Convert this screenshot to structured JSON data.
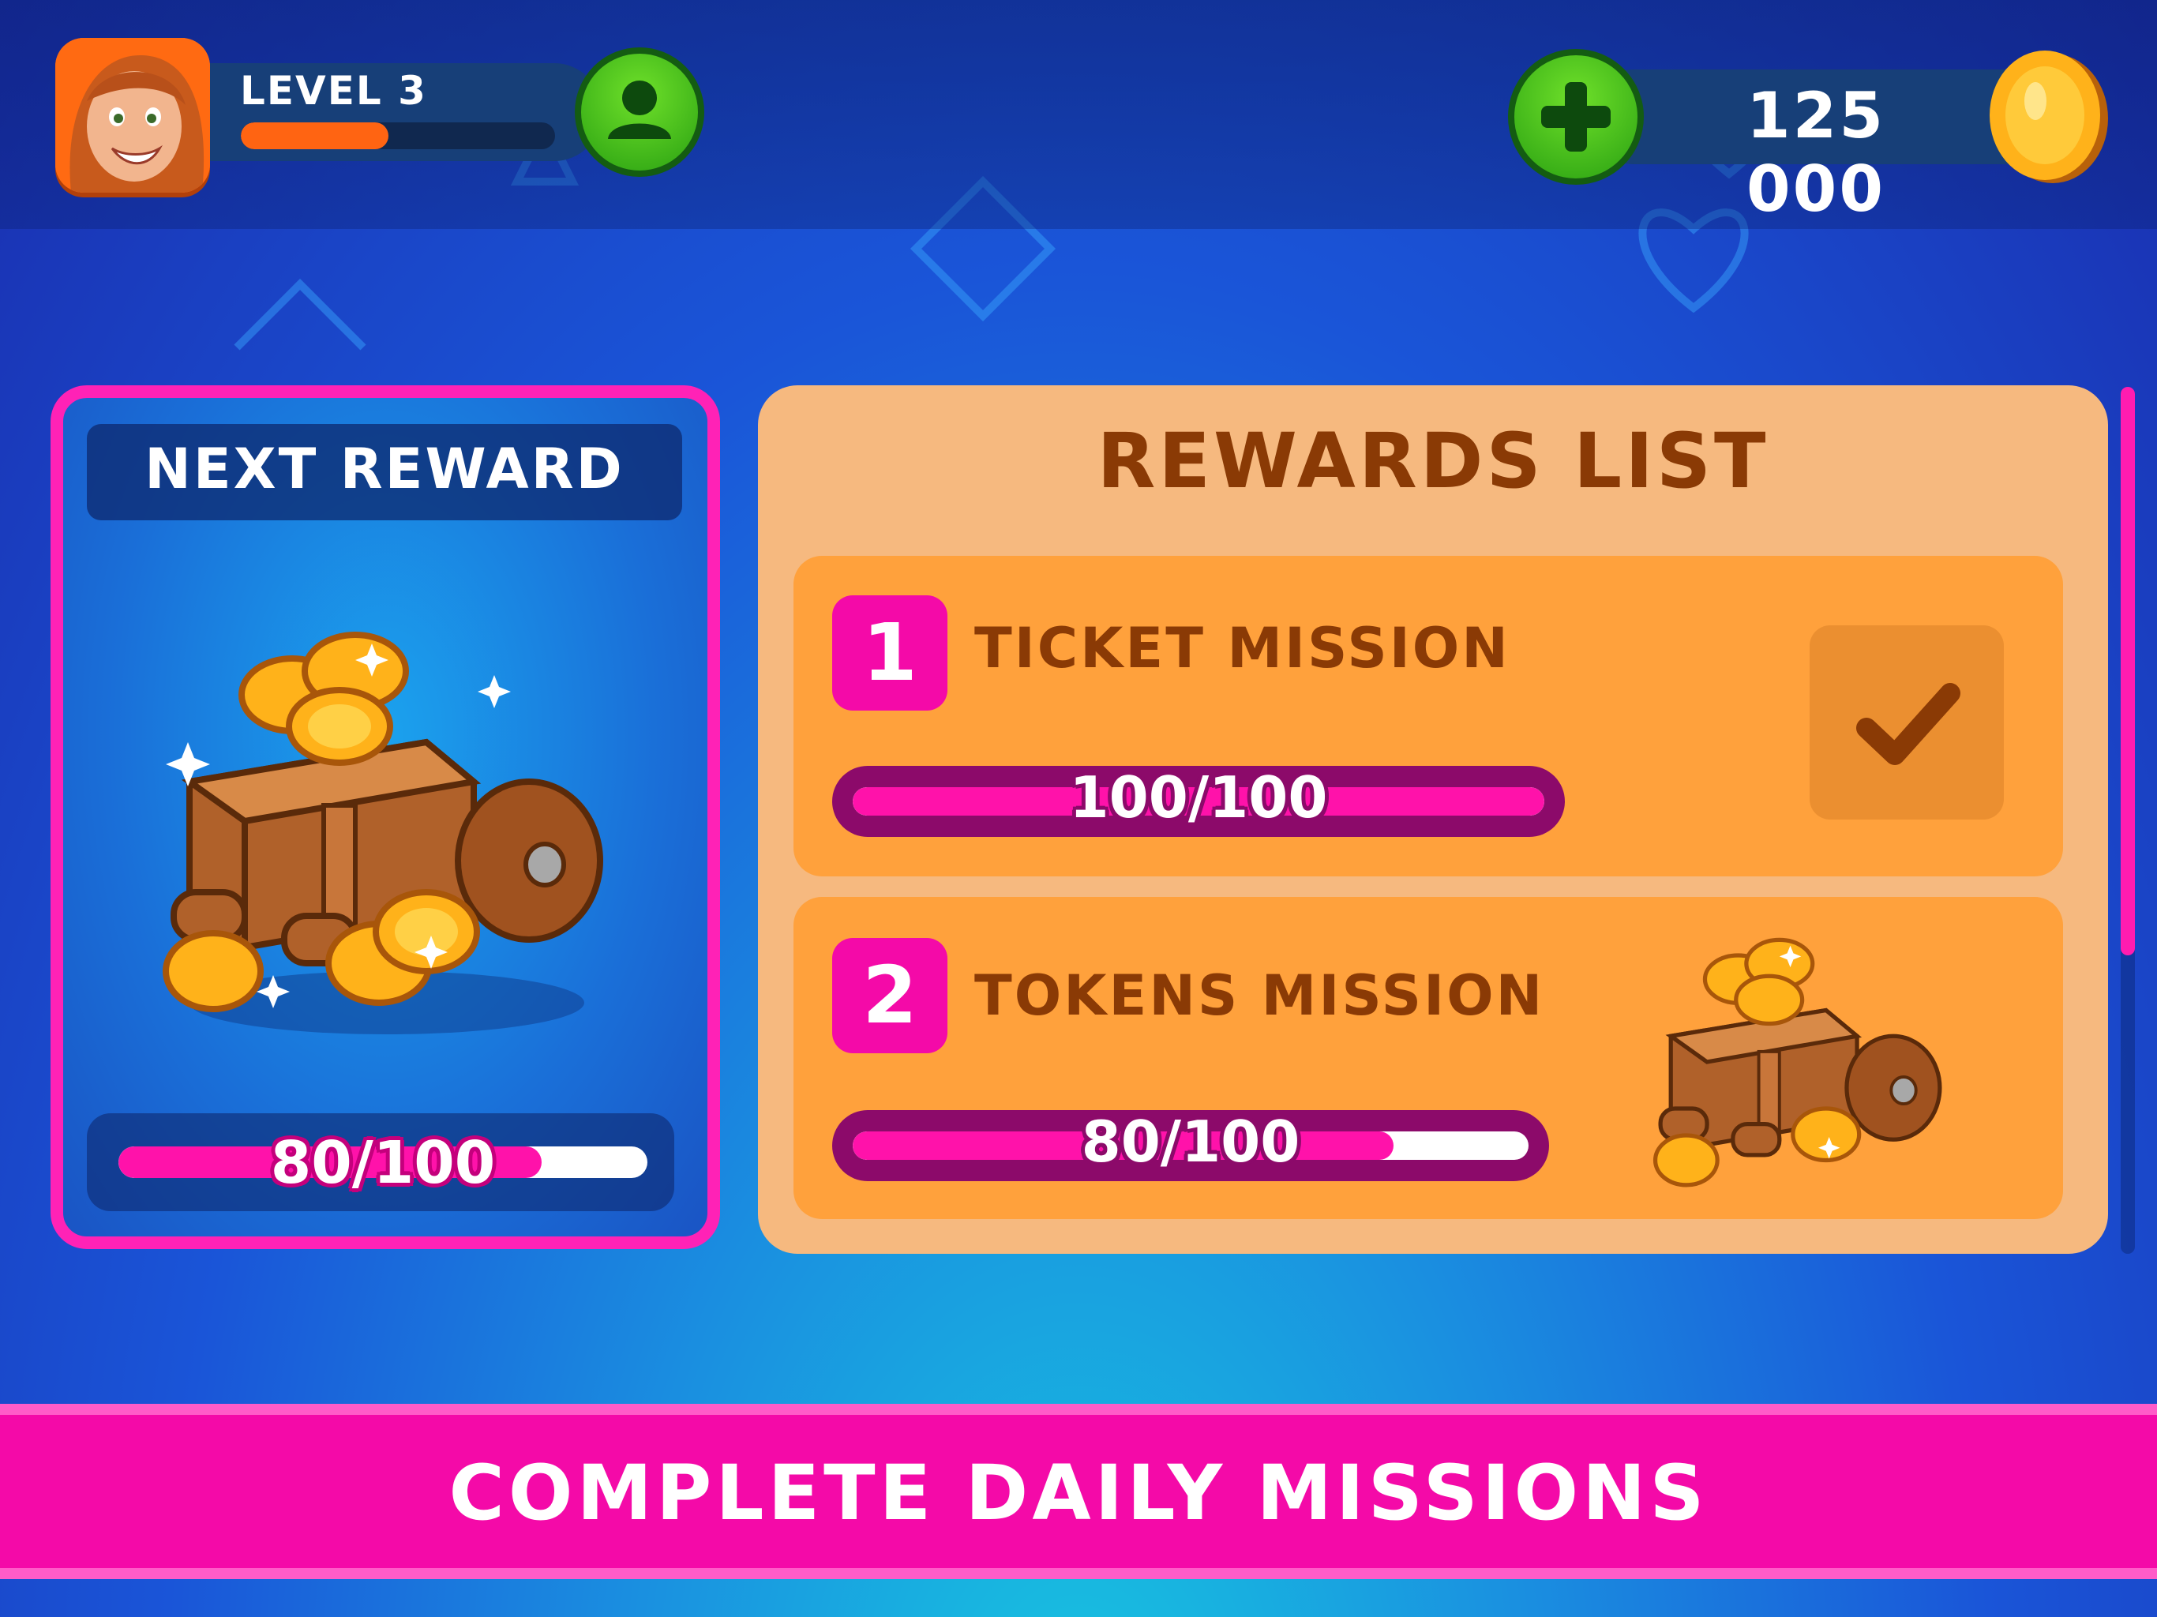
{
  "header": {
    "level_label": "LEVEL 3",
    "xp_progress": 0.47,
    "coin_amount": "125 000",
    "icons": {
      "avatar": "player-avatar",
      "profile": "profile-icon",
      "add_coins": "plus-icon",
      "coin": "coin-icon"
    }
  },
  "next_reward": {
    "title": "NEXT REWARD",
    "progress_text": "80/100",
    "progress": 0.8,
    "icon": "coin-cart-icon"
  },
  "rewards_list": {
    "title": "REWARDS LIST",
    "missions": [
      {
        "number": "1",
        "label": "TICKET MISSION",
        "progress_text": "100/100",
        "progress": 1.0,
        "status_icon": "checkmark-icon"
      },
      {
        "number": "2",
        "label": "TOKENS MISSION",
        "progress_text": "80/100",
        "progress": 0.8,
        "reward_icon": "coin-cart-icon"
      }
    ]
  },
  "banner": {
    "text": "COMPLETE DAILY MISSIONS"
  },
  "colors": {
    "accent_pink": "#f40aa8",
    "panel_orange": "#ffa13c",
    "title_brown": "#8a3a05",
    "button_green": "#2aa112"
  }
}
